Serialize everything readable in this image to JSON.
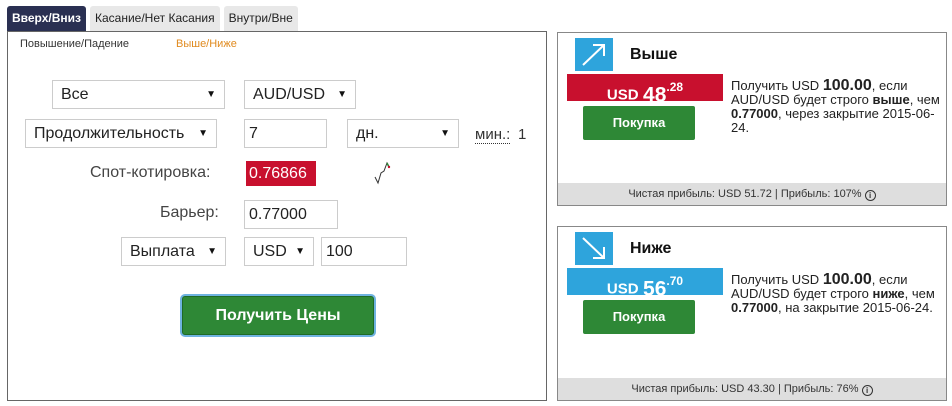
{
  "tabs": [
    {
      "label": "Вверх/Вниз",
      "active": true
    },
    {
      "label": "Касание/Нет Касания",
      "active": false
    },
    {
      "label": "Внутри/Вне",
      "active": false
    }
  ],
  "subtabs": [
    {
      "label": "Повышение/Падение",
      "active": false
    },
    {
      "label": "Выше/Ниже",
      "active": true
    }
  ],
  "form": {
    "market": "Все",
    "asset": "AUD/USD",
    "duration_type": "Продолжительность",
    "duration_value": "7",
    "duration_unit": "дн.",
    "min_label": "мин.:",
    "min_value": "1",
    "spot_label": "Спот-котировка:",
    "spot_value": "0.76866",
    "barrier_label": "Барьер:",
    "barrier_value": "0.77000",
    "payout_type": "Выплата",
    "currency": "USD",
    "amount": "100",
    "get_prices_label": "Получить Цены"
  },
  "contracts": {
    "higher": {
      "title": "Выше",
      "currency": "USD",
      "price_main": "48",
      "price_sup": ".28",
      "buy_label": "Покупка",
      "desc_1": "Получить USD ",
      "desc_amount": "100.00",
      "desc_2": ", если AUD/USD будет строго ",
      "desc_dir": "выше",
      "desc_3": ", чем ",
      "desc_barrier": "0.77000",
      "desc_4": ", через закрытие 2015-06-24.",
      "footer": "Чистая прибыль: USD 51.72 | Прибыль: 107%"
    },
    "lower": {
      "title": "Ниже",
      "currency": "USD",
      "price_main": "56",
      "price_sup": ".70",
      "buy_label": "Покупка",
      "desc_1": "Получить USD ",
      "desc_amount": "100.00",
      "desc_2": ", если AUD/USD будет строго ",
      "desc_dir": "ниже",
      "desc_3": ", чем ",
      "desc_barrier": "0.77000",
      "desc_4": ", на закрытие 2015-06-24.",
      "footer": "Чистая прибыль: USD 43.30 | Прибыль: 76%"
    }
  },
  "icons": {
    "higher": "arrow-up-right-icon",
    "lower": "arrow-down-right-icon",
    "info": "info-icon",
    "caret": "caret-down-icon",
    "spark": "sparkline-icon"
  },
  "colors": {
    "active_tab": "#2a3052",
    "subtab_active": "#e08a1e",
    "spot_bg": "#c8102e",
    "higher_price_bg": "#c8102e",
    "lower_price_bg": "#2ea4dc",
    "buy_bg": "#2e8836",
    "icon_bg": "#2ea4dc"
  }
}
